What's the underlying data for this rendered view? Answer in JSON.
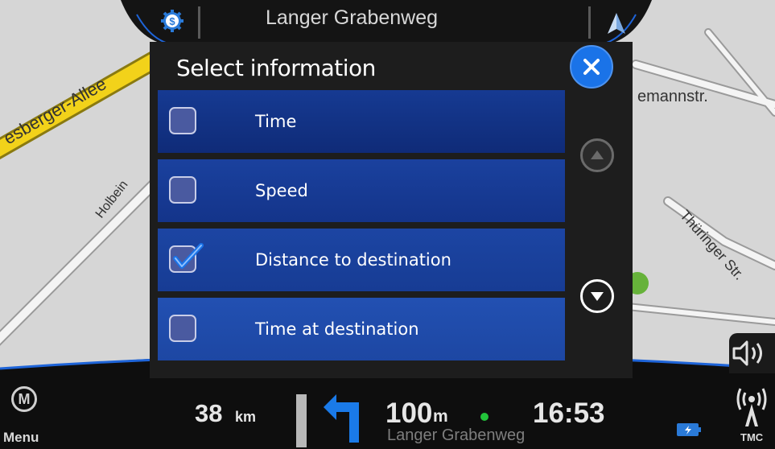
{
  "top_bar": {
    "street": "Langer Grabenweg",
    "settings_icon": "navigation-settings-icon",
    "north_icon": "north-arrow-icon"
  },
  "map": {
    "streets": [
      "esberger-Allee",
      "emannstr.",
      "Holbein",
      "Thüringer Str."
    ]
  },
  "dialog": {
    "title": "Select information",
    "close_icon": "close-icon",
    "items": [
      {
        "label": "Time",
        "checked": false
      },
      {
        "label": "Speed",
        "checked": false
      },
      {
        "label": "Distance to destination",
        "checked": true
      },
      {
        "label": "Time at destination",
        "checked": false
      }
    ],
    "scroll_up_icon": "scroll-up-icon",
    "scroll_down_icon": "scroll-down-icon"
  },
  "bottom_bar": {
    "menu_letter": "M",
    "menu_label": "Menu",
    "distance_value": "38",
    "distance_unit": "km",
    "next_turn_distance": "100",
    "next_turn_unit": "m",
    "clock": "16:53",
    "street": "Langer Grabenweg",
    "tmc_label": "TMC"
  },
  "colors": {
    "dialog_bg": "#1d1d1d",
    "row_bg_dark": "#102a7a",
    "row_bg_light": "#1c45a3",
    "accent_blue": "#1a73e8",
    "map_bg": "#d6d6d6",
    "highway_yellow": "#f2d21a"
  }
}
